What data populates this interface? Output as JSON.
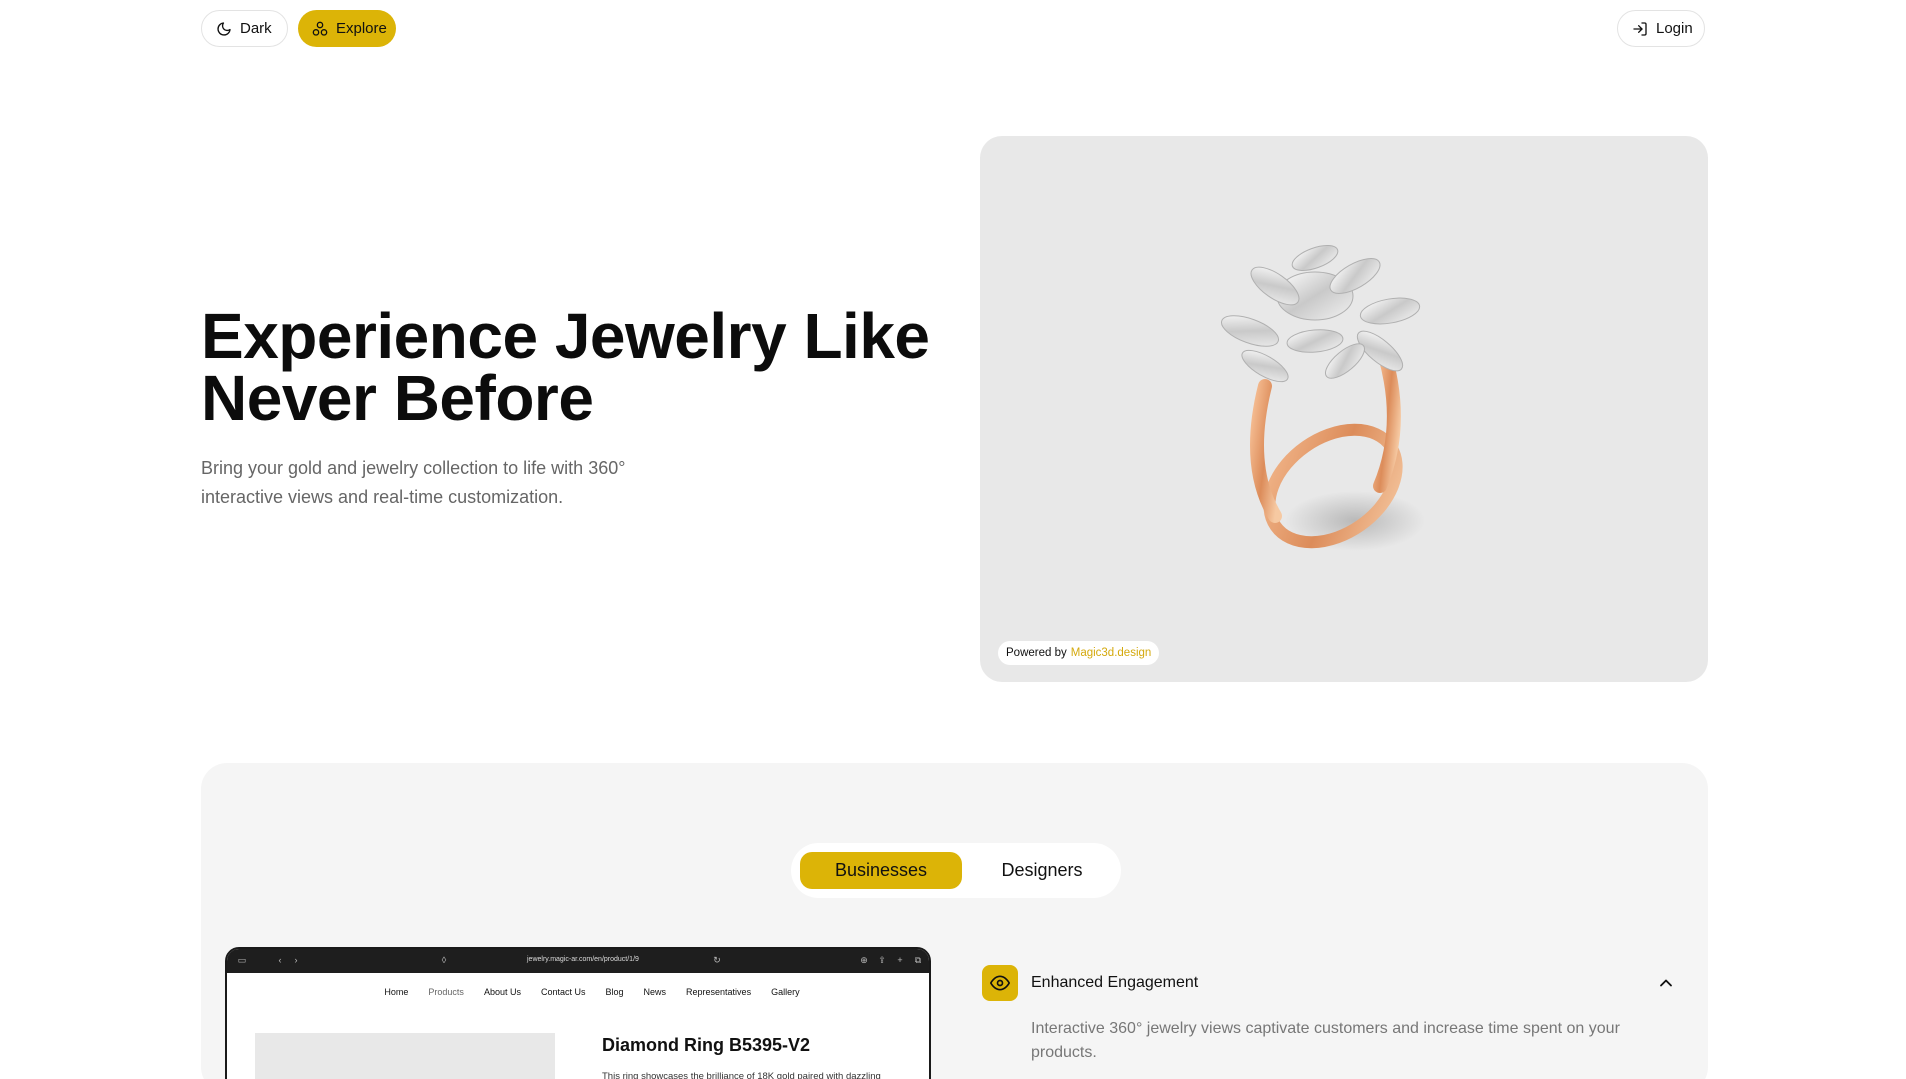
{
  "nav": {
    "dark_label": "Dark",
    "explore_label": "Explore",
    "login_label": "Login"
  },
  "hero": {
    "title_line1": "Experience Jewelry Like",
    "title_line2": "Never Before",
    "subtitle_line1": "Bring your gold and jewelry collection to life with 360°",
    "subtitle_line2": "interactive views and real-time customization.",
    "powered_by": "Powered by",
    "powered_brand": "Magic3d.design"
  },
  "tabs": {
    "businesses": "Businesses",
    "designers": "Designers",
    "selected": "Businesses"
  },
  "browser": {
    "url": "jewelry.magic-ar.com/en/product/1/9",
    "nav_items": [
      "Home",
      "Products",
      "About Us",
      "Contact Us",
      "Blog",
      "News",
      "Representatives",
      "Gallery"
    ],
    "product_title": "Diamond Ring B5395-V2",
    "product_desc": "This ring showcases the brilliance of 18K gold paired with dazzling"
  },
  "feature": {
    "icon": "eye-icon",
    "title": "Enhanced Engagement",
    "description": "Interactive 360° jewelry views captivate customers and increase time spent on your products.",
    "expanded": true
  },
  "colors": {
    "accent": "#dcb407",
    "brand_link": "#d4a90d",
    "card_bg": "#e8e8e8",
    "section_bg": "#f5f5f5"
  }
}
